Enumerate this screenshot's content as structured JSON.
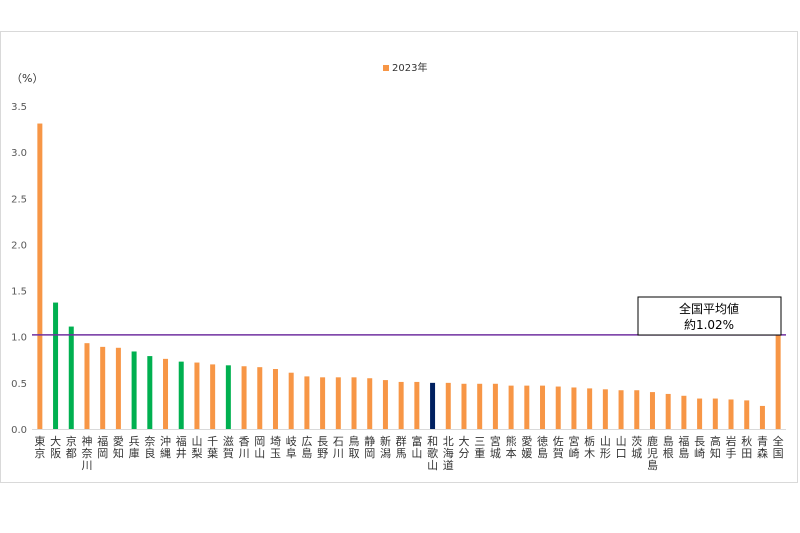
{
  "chart_data": {
    "type": "bar",
    "unit_label": "（%）",
    "legend": [
      {
        "name": "2023年",
        "color": "#F79646"
      }
    ],
    "ylim": [
      0,
      3.5
    ],
    "yticks": [
      "0.0",
      "0.5",
      "1.0",
      "1.5",
      "2.0",
      "2.5",
      "3.0",
      "3.5"
    ],
    "ytick_values": [
      0,
      0.5,
      1.0,
      1.5,
      2.0,
      2.5,
      3.0,
      3.5
    ],
    "grid": false,
    "categories": [
      "東京",
      "大阪",
      "京都",
      "神奈川",
      "福岡",
      "愛知",
      "兵庫",
      "奈良",
      "沖縄",
      "福井",
      "山梨",
      "千葉",
      "滋賀",
      "香川",
      "岡山",
      "埼玉",
      "岐阜",
      "広島",
      "長野",
      "石川",
      "鳥取",
      "静岡",
      "新潟",
      "群馬",
      "富山",
      "和歌山",
      "北海道",
      "大分",
      "三重",
      "宮城",
      "熊本",
      "愛媛",
      "徳島",
      "佐賀",
      "宮崎",
      "栃木",
      "山形",
      "山口",
      "茨城",
      "鹿児島",
      "島根",
      "福島",
      "長崎",
      "高知",
      "岩手",
      "秋田",
      "青森",
      "全国"
    ],
    "values": [
      3.31,
      1.37,
      1.11,
      0.93,
      0.89,
      0.88,
      0.84,
      0.79,
      0.76,
      0.73,
      0.72,
      0.7,
      0.69,
      0.68,
      0.67,
      0.65,
      0.61,
      0.57,
      0.56,
      0.56,
      0.56,
      0.55,
      0.53,
      0.51,
      0.51,
      0.5,
      0.5,
      0.49,
      0.49,
      0.49,
      0.47,
      0.47,
      0.47,
      0.46,
      0.45,
      0.44,
      0.43,
      0.42,
      0.42,
      0.4,
      0.38,
      0.36,
      0.33,
      0.33,
      0.32,
      0.31,
      0.25,
      1.02
    ],
    "bar_colors": [
      "#F79646",
      "#00B050",
      "#00B050",
      "#F79646",
      "#F79646",
      "#F79646",
      "#00B050",
      "#00B050",
      "#F79646",
      "#00B050",
      "#F79646",
      "#F79646",
      "#00B050",
      "#F79646",
      "#F79646",
      "#F79646",
      "#F79646",
      "#F79646",
      "#F79646",
      "#F79646",
      "#F79646",
      "#F79646",
      "#F79646",
      "#F79646",
      "#F79646",
      "#002060",
      "#F79646",
      "#F79646",
      "#F79646",
      "#F79646",
      "#F79646",
      "#F79646",
      "#F79646",
      "#F79646",
      "#F79646",
      "#F79646",
      "#F79646",
      "#F79646",
      "#F79646",
      "#F79646",
      "#F79646",
      "#F79646",
      "#F79646",
      "#F79646",
      "#F79646",
      "#F79646",
      "#F79646",
      "#F79646"
    ],
    "reference_line": {
      "value": 1.02,
      "color": "#7030A0"
    },
    "callout": {
      "line1": "全国平均値",
      "line2": "約1.02%"
    }
  }
}
